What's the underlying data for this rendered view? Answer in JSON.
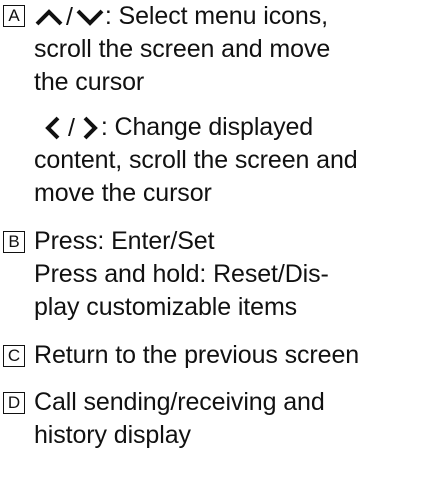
{
  "sections": [
    {
      "key": "A",
      "lines": {
        "l1_suffix": ": Select menu icons,",
        "l2": "scroll the screen and move",
        "l3": "the cursor",
        "l4_suffix": ": Change displayed",
        "l5": "content, scroll the screen and",
        "l6": "move the cursor"
      },
      "separator": "/",
      "icons": [
        "chevron-up-icon",
        "chevron-down-icon",
        "chevron-left-icon",
        "chevron-right-icon"
      ]
    },
    {
      "key": "B",
      "lines": [
        "Press: Enter/Set",
        "Press and hold: Reset/Dis-",
        "play customizable items"
      ]
    },
    {
      "key": "C",
      "lines": [
        "Return to the previous screen"
      ]
    },
    {
      "key": "D",
      "lines": [
        "Call sending/receiving and",
        "history display"
      ]
    }
  ]
}
